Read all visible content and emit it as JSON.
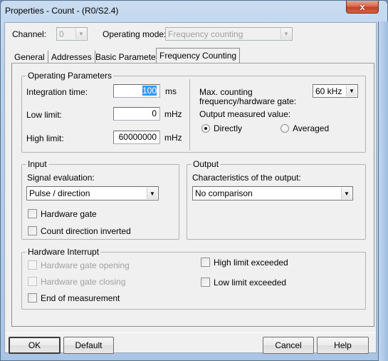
{
  "window": {
    "title": "Properties - Count - (R0/S2.4)",
    "close_label": "x"
  },
  "header": {
    "channel_label": "Channel:",
    "channel_value": "0",
    "mode_label": "Operating mode:",
    "mode_value": "Frequency counting"
  },
  "tabs": [
    {
      "label": "General",
      "active": false
    },
    {
      "label": "Addresses",
      "active": false
    },
    {
      "label": "Basic Parameters",
      "active": false
    },
    {
      "label": "Frequency Counting",
      "active": true
    }
  ],
  "operating_parameters": {
    "title": "Operating Parameters",
    "integration_time_label": "Integration time:",
    "integration_time_value": "100",
    "integration_time_unit": "ms",
    "low_limit_label": "Low limit:",
    "low_limit_value": "0",
    "low_limit_unit": "mHz",
    "high_limit_label": "High limit:",
    "high_limit_value": "60000000",
    "high_limit_unit": "mHz",
    "max_freq_label_line1": "Max. counting",
    "max_freq_label_line2": "frequency/hardware gate:",
    "max_freq_value": "60 kHz",
    "output_value_label": "Output measured value:",
    "radio_directly": "Directly",
    "radio_averaged": "Averaged",
    "selected_output": "Directly"
  },
  "input": {
    "title": "Input",
    "signal_label": "Signal evaluation:",
    "signal_value": "Pulse / direction",
    "hardware_gate": {
      "label": "Hardware gate",
      "checked": false
    },
    "count_direction_inverted": {
      "label": "Count direction inverted",
      "checked": false
    }
  },
  "output": {
    "title": "Output",
    "characteristics_label": "Characteristics of the output:",
    "characteristics_value": "No comparison"
  },
  "hardware_interrupt": {
    "title": "Hardware Interrupt",
    "gate_opening": {
      "label": "Hardware gate opening",
      "checked": false,
      "enabled": false
    },
    "gate_closing": {
      "label": "Hardware gate closing",
      "checked": false,
      "enabled": false
    },
    "end_of_measurement": {
      "label": "End of measurement",
      "checked": false,
      "enabled": true
    },
    "high_limit_exceeded": {
      "label": "High limit exceeded",
      "checked": false,
      "enabled": true
    },
    "low_limit_exceeded": {
      "label": "Low limit exceeded",
      "checked": false,
      "enabled": true
    }
  },
  "buttons": {
    "ok": "OK",
    "default": "Default",
    "cancel": "Cancel",
    "help": "Help"
  },
  "icons": {
    "dropdown_arrow": "▼",
    "close": "close-icon"
  }
}
